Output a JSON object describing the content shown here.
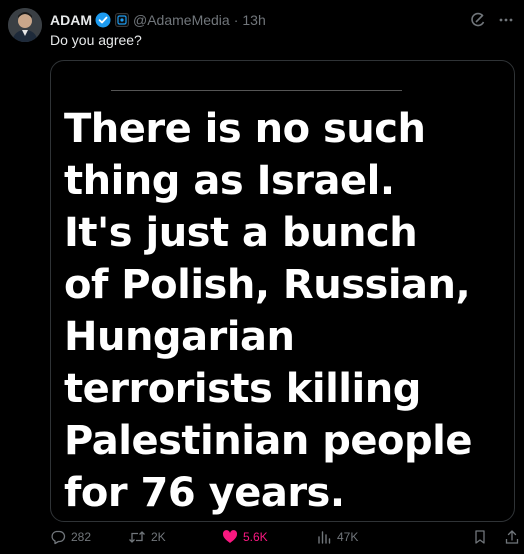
{
  "author": {
    "name": "ADAM",
    "handle": "@AdameMedia",
    "separator": "·",
    "time": "13h"
  },
  "tweet": {
    "text": "Do you agree?"
  },
  "media": {
    "lines": [
      "There is no such",
      "thing as Israel.",
      "It's just a bunch",
      "of Polish, Russian,",
      "Hungarian",
      "terrorists killing",
      "Palestinian people",
      "for 76 years."
    ]
  },
  "actions": {
    "replies": "282",
    "reposts": "2K",
    "likes": "5.6K",
    "views": "47K"
  },
  "colors": {
    "background": "#000000",
    "text": "#e7e9ea",
    "muted": "#71767b",
    "verified": "#1d9bf0",
    "like": "#f91880"
  },
  "icons": [
    "verified-badge-icon",
    "affiliate-badge-icon",
    "grok-icon",
    "more-icon",
    "reply-icon",
    "repost-icon",
    "like-icon",
    "views-icon",
    "bookmark-icon",
    "share-icon"
  ]
}
